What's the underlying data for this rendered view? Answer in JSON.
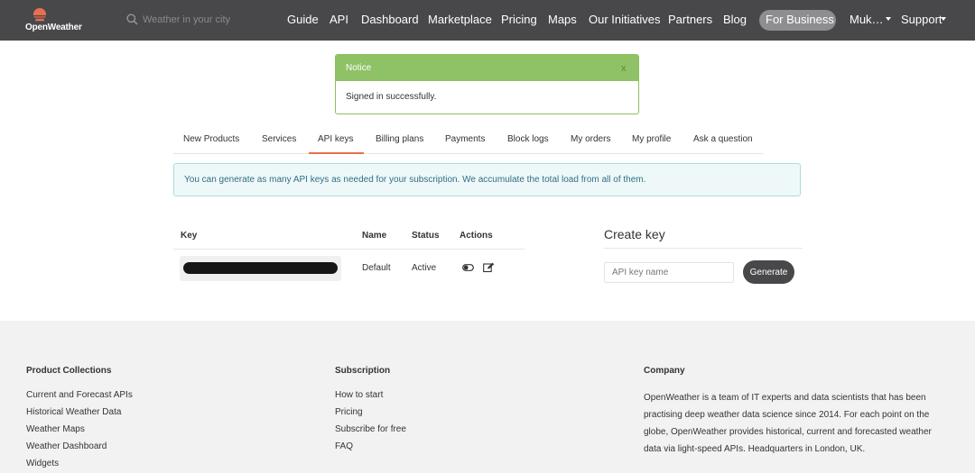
{
  "brand": {
    "name": "OpenWeather",
    "colors": {
      "navbar": "#48484a",
      "accent": "#e96e50",
      "notice_green": "#8fc166"
    }
  },
  "search": {
    "placeholder": "Weather in your city",
    "icon": "search-icon"
  },
  "nav": {
    "links": [
      "Guide",
      "API",
      "Dashboard",
      "Marketplace",
      "Pricing",
      "Maps",
      "Our Initiatives",
      "Partners",
      "Blog"
    ],
    "business": "For Business",
    "user": "Muk…",
    "support": "Support"
  },
  "notice": {
    "title": "Notice",
    "close": "x",
    "message": "Signed in successfully."
  },
  "tabs": {
    "items": [
      "New Products",
      "Services",
      "API keys",
      "Billing plans",
      "Payments",
      "Block logs",
      "My orders",
      "My profile",
      "Ask a question"
    ],
    "active": "API keys"
  },
  "alert": {
    "text": "You can generate as many API keys as needed for your subscription. We accumulate the total load from all of them."
  },
  "keys_table": {
    "headers": [
      "Key",
      "Name",
      "Status",
      "Actions"
    ],
    "rows": [
      {
        "key": "",
        "name": "Default",
        "status": "Active"
      }
    ]
  },
  "create_key": {
    "title": "Create key",
    "placeholder": "API key name",
    "button": "Generate"
  },
  "footer": {
    "product_collections": {
      "title": "Product Collections",
      "links": [
        "Current and Forecast APIs",
        "Historical Weather Data",
        "Weather Maps",
        "Weather Dashboard",
        "Widgets"
      ]
    },
    "subscription": {
      "title": "Subscription",
      "links": [
        "How to start",
        "Pricing",
        "Subscribe for free",
        "FAQ"
      ]
    },
    "company": {
      "title": "Company",
      "text": "OpenWeather is a team of IT experts and data scientists that has been practising deep weather data science since 2014. For each point on the globe, OpenWeather provides historical, current and forecasted weather data via light-speed APIs. Headquarters in London, UK."
    }
  }
}
